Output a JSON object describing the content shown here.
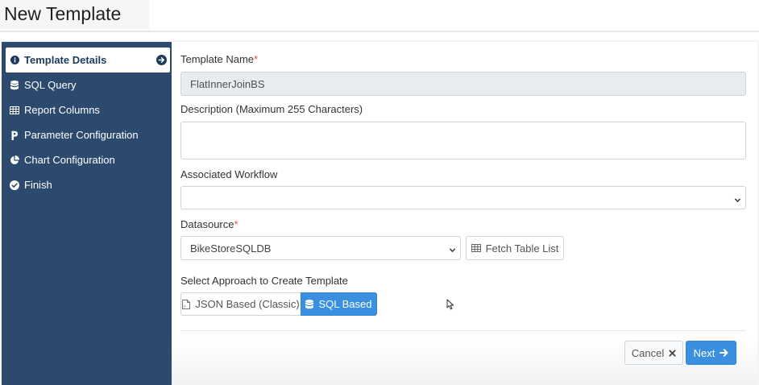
{
  "page": {
    "title": "New Template"
  },
  "sidebar": {
    "items": [
      {
        "label": "Template Details",
        "icon": "info-circle-icon",
        "active": true
      },
      {
        "label": "SQL Query",
        "icon": "database-icon"
      },
      {
        "label": "Report Columns",
        "icon": "table-icon"
      },
      {
        "label": "Parameter Configuration",
        "icon": "parameter-icon"
      },
      {
        "label": "Chart Configuration",
        "icon": "pie-chart-icon"
      },
      {
        "label": "Finish",
        "icon": "check-circle-icon"
      }
    ]
  },
  "form": {
    "template_name": {
      "label": "Template Name",
      "required_mark": "*",
      "value": "FlatInnerJoinBS"
    },
    "description": {
      "label": "Description (Maximum 255 Characters)",
      "value": ""
    },
    "workflow": {
      "label": "Associated Workflow",
      "selected": ""
    },
    "datasource": {
      "label": "Datasource",
      "required_mark": "*",
      "selected": "BikeStoreSQLDB"
    },
    "fetch_button": "Fetch Table List",
    "approach": {
      "label": "Select Approach to Create Template",
      "options": [
        "JSON Based (Classic)",
        "SQL Based"
      ],
      "selected": "SQL Based"
    }
  },
  "footer": {
    "cancel": "Cancel",
    "next": "Next"
  },
  "colors": {
    "sidebar": "#2c4a6e",
    "primary": "#3b8fe0",
    "required": "#d9534f"
  }
}
